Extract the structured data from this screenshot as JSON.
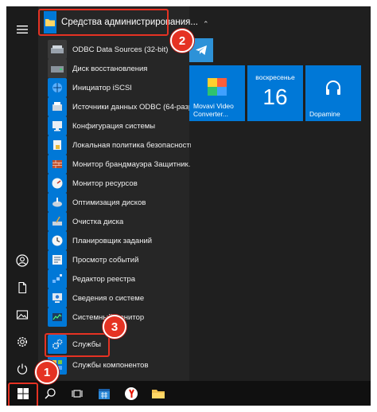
{
  "start_menu": {
    "folder_label": "Средства администрирования...",
    "items": [
      {
        "label": "ODBC Data Sources (32-bit)",
        "icon": "odbc-icon"
      },
      {
        "label": "Диск восстановления",
        "icon": "recovery-drive-icon"
      },
      {
        "label": "Инициатор iSCSI",
        "icon": "iscsi-icon"
      },
      {
        "label": "Источники данных ODBC (64-разр.",
        "icon": "odbc64-icon"
      },
      {
        "label": "Конфигурация системы",
        "icon": "msconfig-icon"
      },
      {
        "label": "Локальная политика безопасности",
        "icon": "security-policy-icon"
      },
      {
        "label": "Монитор брандмауэра Защитник...",
        "icon": "firewall-icon"
      },
      {
        "label": "Монитор ресурсов",
        "icon": "resource-monitor-icon"
      },
      {
        "label": "Оптимизация дисков",
        "icon": "defrag-icon"
      },
      {
        "label": "Очистка диска",
        "icon": "disk-cleanup-icon"
      },
      {
        "label": "Планировщик заданий",
        "icon": "task-scheduler-icon"
      },
      {
        "label": "Просмотр событий",
        "icon": "event-viewer-icon"
      },
      {
        "label": "Редактор реестра",
        "icon": "regedit-icon"
      },
      {
        "label": "Сведения о системе",
        "icon": "system-info-icon"
      },
      {
        "label": "Системный монитор",
        "icon": "perfmon-icon"
      },
      {
        "label": "Службы",
        "icon": "services-icon"
      },
      {
        "label": "Службы компонентов",
        "icon": "component-services-icon"
      }
    ]
  },
  "tiles": {
    "movavi": "Movavi Video Converter...",
    "calendar_day": "воскресенье",
    "calendar_date": "16",
    "dopamine": "Dopamine"
  },
  "callouts": [
    "1",
    "2",
    "3"
  ],
  "colors": {
    "accent": "#0078d7",
    "highlight": "#e53223",
    "menu_bg": "#262626",
    "taskbar_bg": "#101010"
  }
}
